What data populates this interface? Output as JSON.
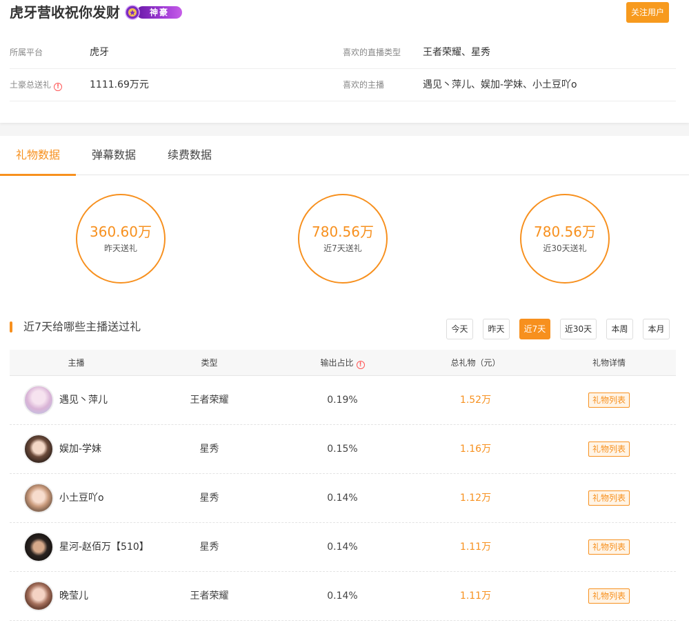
{
  "profile": {
    "name": "虎牙营收祝你发财",
    "badge_label": "神豪",
    "follow_label": "关注用户"
  },
  "info": {
    "platform_label": "所属平台",
    "platform_value": "虎牙",
    "genre_label": "喜欢的直播类型",
    "genre_value": "王者荣耀、星秀",
    "total_label": "土豪总送礼",
    "total_value": "1111.69万元",
    "anchors_label": "喜欢的主播",
    "anchors_value": "遇见丶萍儿、娱加-学妹、小土豆吖o"
  },
  "tabs": [
    {
      "label": "礼物数据",
      "active": true
    },
    {
      "label": "弹幕数据",
      "active": false
    },
    {
      "label": "续费数据",
      "active": false
    }
  ],
  "stats": [
    {
      "value": "360.60万",
      "label": "昨天送礼"
    },
    {
      "value": "780.56万",
      "label": "近7天送礼"
    },
    {
      "value": "780.56万",
      "label": "近30天送礼"
    }
  ],
  "section": {
    "title": "近7天给哪些主播送过礼"
  },
  "ranges": [
    {
      "label": "今天",
      "active": false
    },
    {
      "label": "昨天",
      "active": false
    },
    {
      "label": "近7天",
      "active": true
    },
    {
      "label": "近30天",
      "active": false
    },
    {
      "label": "本周",
      "active": false
    },
    {
      "label": "本月",
      "active": false
    }
  ],
  "table": {
    "headers": [
      "主播",
      "类型",
      "输出占比",
      "总礼物（元）",
      "礼物详情"
    ],
    "rows": [
      {
        "name": "遇见丶萍儿",
        "type": "王者荣耀",
        "share": "0.19%",
        "total": "1.52万",
        "action": "礼物列表"
      },
      {
        "name": "娱加-学妹",
        "type": "星秀",
        "share": "0.15%",
        "total": "1.16万",
        "action": "礼物列表"
      },
      {
        "name": "小土豆吖o",
        "type": "星秀",
        "share": "0.14%",
        "total": "1.12万",
        "action": "礼物列表"
      },
      {
        "name": "星河-赵佰万【510】",
        "type": "星秀",
        "share": "0.14%",
        "total": "1.11万",
        "action": "礼物列表"
      },
      {
        "name": "晚莹儿",
        "type": "王者荣耀",
        "share": "0.14%",
        "total": "1.11万",
        "action": "礼物列表"
      }
    ]
  },
  "colors": {
    "accent": "#f7901e",
    "badge": "#a13bd6"
  },
  "icons": {
    "badge": "crown-medal-icon",
    "info": "info-circle-icon",
    "avatar": "avatar-photo"
  }
}
